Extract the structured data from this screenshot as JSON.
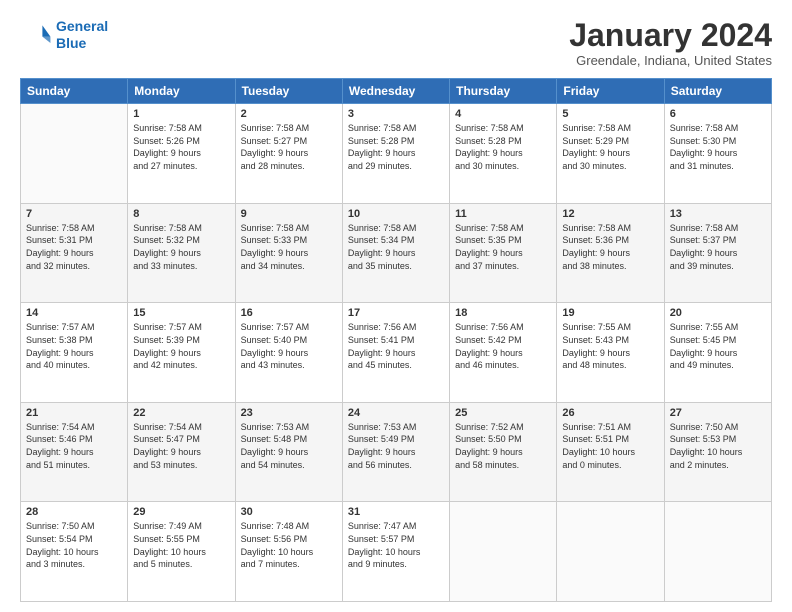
{
  "logo": {
    "line1": "General",
    "line2": "Blue"
  },
  "header": {
    "title": "January 2024",
    "location": "Greendale, Indiana, United States"
  },
  "weekdays": [
    "Sunday",
    "Monday",
    "Tuesday",
    "Wednesday",
    "Thursday",
    "Friday",
    "Saturday"
  ],
  "weeks": [
    [
      {
        "day": "",
        "content": ""
      },
      {
        "day": "1",
        "content": "Sunrise: 7:58 AM\nSunset: 5:26 PM\nDaylight: 9 hours\nand 27 minutes."
      },
      {
        "day": "2",
        "content": "Sunrise: 7:58 AM\nSunset: 5:27 PM\nDaylight: 9 hours\nand 28 minutes."
      },
      {
        "day": "3",
        "content": "Sunrise: 7:58 AM\nSunset: 5:28 PM\nDaylight: 9 hours\nand 29 minutes."
      },
      {
        "day": "4",
        "content": "Sunrise: 7:58 AM\nSunset: 5:28 PM\nDaylight: 9 hours\nand 30 minutes."
      },
      {
        "day": "5",
        "content": "Sunrise: 7:58 AM\nSunset: 5:29 PM\nDaylight: 9 hours\nand 30 minutes."
      },
      {
        "day": "6",
        "content": "Sunrise: 7:58 AM\nSunset: 5:30 PM\nDaylight: 9 hours\nand 31 minutes."
      }
    ],
    [
      {
        "day": "7",
        "content": "Sunrise: 7:58 AM\nSunset: 5:31 PM\nDaylight: 9 hours\nand 32 minutes."
      },
      {
        "day": "8",
        "content": "Sunrise: 7:58 AM\nSunset: 5:32 PM\nDaylight: 9 hours\nand 33 minutes."
      },
      {
        "day": "9",
        "content": "Sunrise: 7:58 AM\nSunset: 5:33 PM\nDaylight: 9 hours\nand 34 minutes."
      },
      {
        "day": "10",
        "content": "Sunrise: 7:58 AM\nSunset: 5:34 PM\nDaylight: 9 hours\nand 35 minutes."
      },
      {
        "day": "11",
        "content": "Sunrise: 7:58 AM\nSunset: 5:35 PM\nDaylight: 9 hours\nand 37 minutes."
      },
      {
        "day": "12",
        "content": "Sunrise: 7:58 AM\nSunset: 5:36 PM\nDaylight: 9 hours\nand 38 minutes."
      },
      {
        "day": "13",
        "content": "Sunrise: 7:58 AM\nSunset: 5:37 PM\nDaylight: 9 hours\nand 39 minutes."
      }
    ],
    [
      {
        "day": "14",
        "content": "Sunrise: 7:57 AM\nSunset: 5:38 PM\nDaylight: 9 hours\nand 40 minutes."
      },
      {
        "day": "15",
        "content": "Sunrise: 7:57 AM\nSunset: 5:39 PM\nDaylight: 9 hours\nand 42 minutes."
      },
      {
        "day": "16",
        "content": "Sunrise: 7:57 AM\nSunset: 5:40 PM\nDaylight: 9 hours\nand 43 minutes."
      },
      {
        "day": "17",
        "content": "Sunrise: 7:56 AM\nSunset: 5:41 PM\nDaylight: 9 hours\nand 45 minutes."
      },
      {
        "day": "18",
        "content": "Sunrise: 7:56 AM\nSunset: 5:42 PM\nDaylight: 9 hours\nand 46 minutes."
      },
      {
        "day": "19",
        "content": "Sunrise: 7:55 AM\nSunset: 5:43 PM\nDaylight: 9 hours\nand 48 minutes."
      },
      {
        "day": "20",
        "content": "Sunrise: 7:55 AM\nSunset: 5:45 PM\nDaylight: 9 hours\nand 49 minutes."
      }
    ],
    [
      {
        "day": "21",
        "content": "Sunrise: 7:54 AM\nSunset: 5:46 PM\nDaylight: 9 hours\nand 51 minutes."
      },
      {
        "day": "22",
        "content": "Sunrise: 7:54 AM\nSunset: 5:47 PM\nDaylight: 9 hours\nand 53 minutes."
      },
      {
        "day": "23",
        "content": "Sunrise: 7:53 AM\nSunset: 5:48 PM\nDaylight: 9 hours\nand 54 minutes."
      },
      {
        "day": "24",
        "content": "Sunrise: 7:53 AM\nSunset: 5:49 PM\nDaylight: 9 hours\nand 56 minutes."
      },
      {
        "day": "25",
        "content": "Sunrise: 7:52 AM\nSunset: 5:50 PM\nDaylight: 9 hours\nand 58 minutes."
      },
      {
        "day": "26",
        "content": "Sunrise: 7:51 AM\nSunset: 5:51 PM\nDaylight: 10 hours\nand 0 minutes."
      },
      {
        "day": "27",
        "content": "Sunrise: 7:50 AM\nSunset: 5:53 PM\nDaylight: 10 hours\nand 2 minutes."
      }
    ],
    [
      {
        "day": "28",
        "content": "Sunrise: 7:50 AM\nSunset: 5:54 PM\nDaylight: 10 hours\nand 3 minutes."
      },
      {
        "day": "29",
        "content": "Sunrise: 7:49 AM\nSunset: 5:55 PM\nDaylight: 10 hours\nand 5 minutes."
      },
      {
        "day": "30",
        "content": "Sunrise: 7:48 AM\nSunset: 5:56 PM\nDaylight: 10 hours\nand 7 minutes."
      },
      {
        "day": "31",
        "content": "Sunrise: 7:47 AM\nSunset: 5:57 PM\nDaylight: 10 hours\nand 9 minutes."
      },
      {
        "day": "",
        "content": ""
      },
      {
        "day": "",
        "content": ""
      },
      {
        "day": "",
        "content": ""
      }
    ]
  ]
}
